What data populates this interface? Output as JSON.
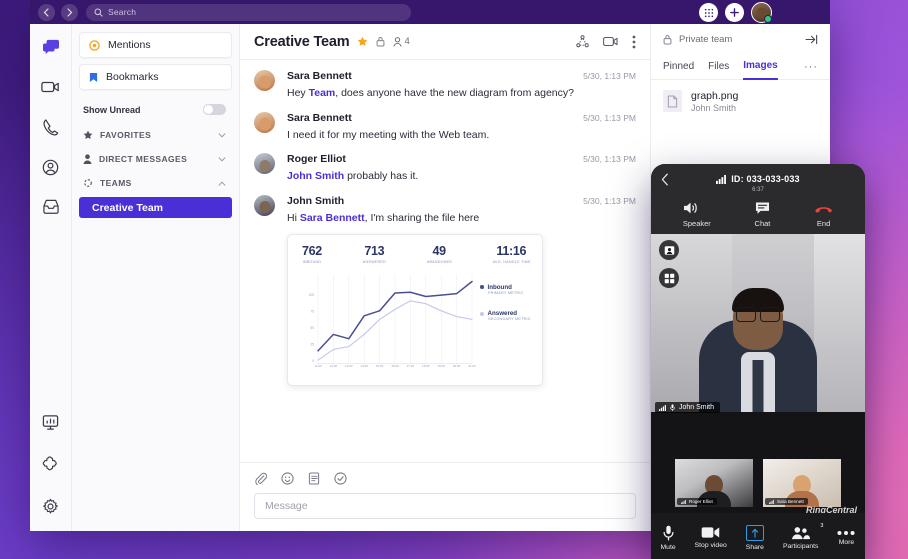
{
  "topbar": {
    "back_icon": "chevron-left-icon",
    "forward_icon": "chevron-right-icon",
    "search_placeholder": "Search",
    "search_icon": "search-icon",
    "dialpad_icon": "dialpad-icon",
    "add_icon": "plus-icon",
    "avatar_icon": "user-avatar"
  },
  "rail": {
    "items": [
      {
        "name": "messages",
        "icon": "chat-bubbles-icon",
        "active": true
      },
      {
        "name": "video",
        "icon": "video-camera-icon",
        "active": false
      },
      {
        "name": "phone",
        "icon": "phone-handset-icon",
        "active": false
      },
      {
        "name": "contacts",
        "icon": "person-circle-icon",
        "active": false
      },
      {
        "name": "fax",
        "icon": "inbox-tray-icon",
        "active": false
      }
    ],
    "bottom": [
      {
        "name": "analytics",
        "icon": "monitor-chart-icon"
      },
      {
        "name": "apps",
        "icon": "puzzle-piece-icon"
      },
      {
        "name": "settings",
        "icon": "gear-icon"
      }
    ]
  },
  "sidebar": {
    "mentions_label": "Mentions",
    "mentions_icon": "at-sign-icon",
    "bookmarks_label": "Bookmarks",
    "bookmarks_icon": "bookmark-icon",
    "show_unread_label": "Show Unread",
    "show_unread_on": false,
    "sections": [
      {
        "label": "FAVORITES",
        "icon": "star-icon",
        "chevron": "chevron-down-icon",
        "expanded": false
      },
      {
        "label": "DIRECT MESSAGES",
        "icon": "person-icon",
        "chevron": "chevron-down-icon",
        "expanded": false
      },
      {
        "label": "TEAMS",
        "icon": "teams-icon",
        "chevron": "chevron-up-icon",
        "expanded": true
      }
    ],
    "selected_team": "Creative Team"
  },
  "conversation": {
    "title": "Creative Team",
    "star_icon": "star-filled-icon",
    "lock_icon": "lock-icon",
    "members_icon": "person-icon",
    "members_count": "4",
    "header_actions": [
      {
        "name": "share-node-icon"
      },
      {
        "name": "video-camera-icon"
      },
      {
        "name": "more-vertical-icon"
      }
    ],
    "messages": [
      {
        "author": "Sara Bennett",
        "time": "5/30, 1:13 PM",
        "avatar": "av-sara",
        "parts": [
          {
            "t": "Hey ",
            "m": false
          },
          {
            "t": "Team",
            "m": true
          },
          {
            "t": ", does anyone have the new diagram from agency?",
            "m": false
          }
        ]
      },
      {
        "author": "Sara Bennett",
        "time": "5/30, 1:13 PM",
        "avatar": "av-sara",
        "parts": [
          {
            "t": "I need it for my meeting with the Web team.",
            "m": false
          }
        ]
      },
      {
        "author": "Roger Elliot",
        "time": "5/30, 1:13 PM",
        "avatar": "av-roger",
        "parts": [
          {
            "t": "John Smith",
            "m": true
          },
          {
            "t": " probably has it.",
            "m": false
          }
        ]
      },
      {
        "author": "John Smith",
        "time": "5/30, 1:13 PM",
        "avatar": "av-john",
        "parts": [
          {
            "t": "Hi ",
            "m": false
          },
          {
            "t": "Sara Bennett",
            "m": true
          },
          {
            "t": ", I'm sharing the file here",
            "m": false
          }
        ]
      }
    ]
  },
  "chart_data": {
    "type": "line",
    "title": "",
    "xlabel": "",
    "ylabel": "",
    "grid": true,
    "legend_position": "right",
    "ylim": [
      0,
      125
    ],
    "yticks": [
      0,
      25,
      50,
      75,
      100
    ],
    "ytick_labels": [
      "0",
      "25",
      "50",
      "75",
      "100"
    ],
    "categories": [
      "11:00",
      "12:00",
      "13:00",
      "14:00",
      "15:00",
      "16:00",
      "17:00",
      "18:00",
      "19:00",
      "20:00",
      "21:00"
    ],
    "series": [
      {
        "name": "Inbound",
        "sublabel": "PRIMARY METRIC",
        "color": "#4a4f92",
        "values": [
          18,
          41,
          35,
          67,
          74,
          99,
          100,
          94,
          96,
          98,
          115
        ]
      },
      {
        "name": "Answered",
        "sublabel": "SECONDARY METRIC",
        "color": "#c7c9e8",
        "values": [
          5,
          20,
          24,
          41,
          62,
          76,
          88,
          84,
          74,
          66,
          62
        ]
      }
    ],
    "kpis": [
      {
        "value": "762",
        "label": "INBOUND"
      },
      {
        "value": "713",
        "label": "ANSWERED"
      },
      {
        "value": "49",
        "label": "ABANDONED"
      },
      {
        "value": "11:16",
        "label": "AVG. HANDLE TIME"
      }
    ]
  },
  "composer": {
    "placeholder": "Message",
    "icons": [
      {
        "name": "attachment-icon"
      },
      {
        "name": "emoji-icon"
      },
      {
        "name": "note-icon"
      },
      {
        "name": "task-check-icon"
      }
    ]
  },
  "right_panel": {
    "privacy_label": "Private team",
    "lock_icon": "lock-icon",
    "expand_icon": "expand-right-icon",
    "tabs": [
      {
        "label": "Pinned",
        "active": false
      },
      {
        "label": "Files",
        "active": false
      },
      {
        "label": "Images",
        "active": true
      }
    ],
    "more_icon": "more-horizontal-icon",
    "files": [
      {
        "name": "graph.png",
        "owner": "John Smith",
        "icon": "file-icon"
      }
    ]
  },
  "phone_call": {
    "back_icon": "chevron-left-icon",
    "signal_icon": "signal-bars-icon",
    "meeting_id": "ID: 033-033-033",
    "timer": "6:37",
    "actions": [
      {
        "label": "Speaker",
        "icon": "speaker-icon"
      },
      {
        "label": "Chat",
        "icon": "chat-icon"
      },
      {
        "label": "End",
        "icon": "end-call-icon"
      }
    ],
    "side_buttons": [
      {
        "name": "participant-view-icon"
      },
      {
        "name": "grid-view-icon"
      }
    ],
    "active_speaker": "John Smith",
    "active_speaker_icons": [
      "signal-bars-icon",
      "microphone-icon"
    ],
    "thumbnails": [
      {
        "name": "Roger Elliot"
      },
      {
        "name": "Sara Bennett"
      }
    ],
    "watermark": "RingCentral",
    "toolbar": [
      {
        "label": "Mute",
        "icon": "microphone-icon",
        "badge": ""
      },
      {
        "label": "Stop video",
        "icon": "video-camera-icon",
        "badge": ""
      },
      {
        "label": "Share",
        "icon": "share-screen-icon",
        "badge": ""
      },
      {
        "label": "Participants",
        "icon": "participants-icon",
        "badge": "3"
      },
      {
        "label": "More",
        "icon": "more-horizontal-icon",
        "badge": ""
      }
    ]
  },
  "colors": {
    "brand_purple": "#4b2fd6",
    "topbar": "#37176b",
    "star": "#f5a623",
    "online": "#2ecc71"
  }
}
